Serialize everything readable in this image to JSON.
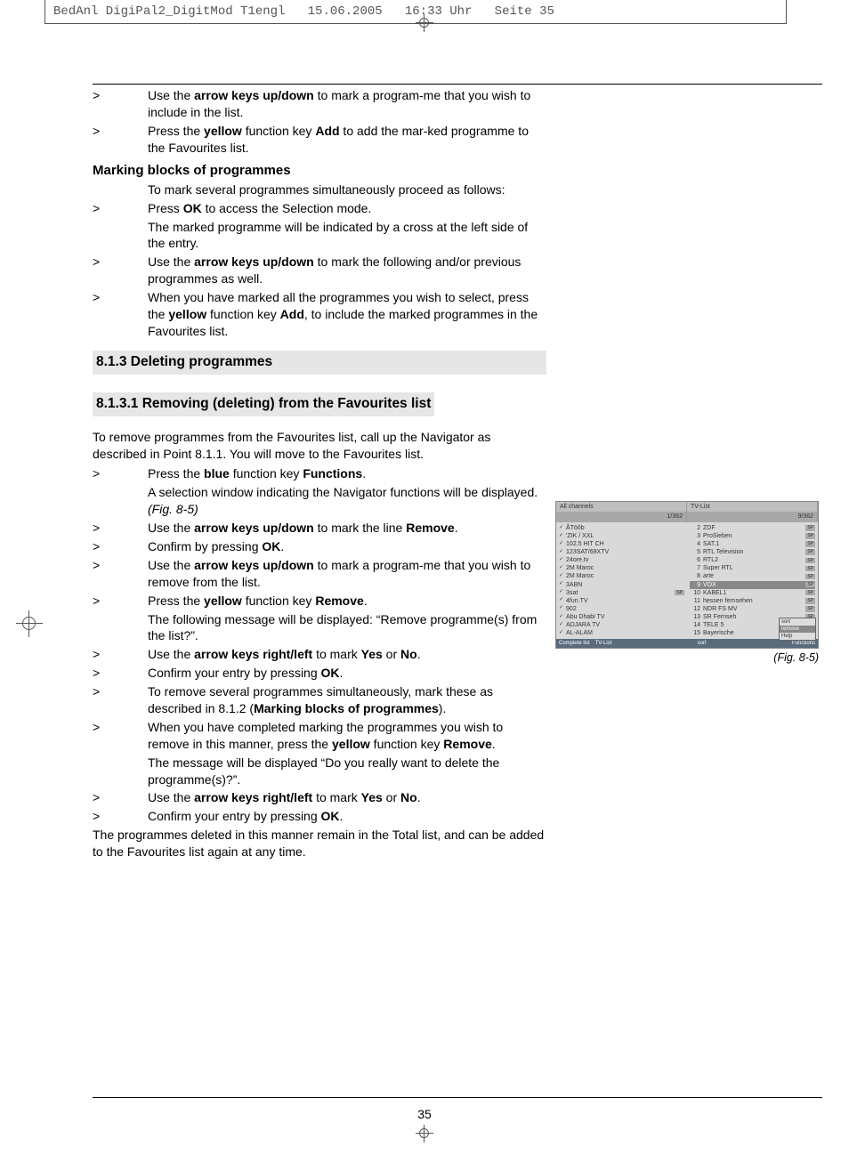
{
  "cropmark_header": "BedAnl DigiPal2_DigitMod T1engl   15.06.2005   16:33 Uhr   Seite 35",
  "page_number": "35",
  "intro_items": [
    {
      "bullet": ">",
      "runs": [
        [
          "",
          "Use the "
        ],
        [
          "b",
          "arrow keys up/down"
        ],
        [
          "",
          " to mark a program-me that you wish to include in the list."
        ]
      ]
    },
    {
      "bullet": ">",
      "runs": [
        [
          "",
          "Press the "
        ],
        [
          "b",
          "yellow"
        ],
        [
          "",
          " function key "
        ],
        [
          "b",
          "Add"
        ],
        [
          "",
          " to add the mar-ked programme to the Favourites list."
        ]
      ]
    }
  ],
  "marking_heading": "Marking blocks of programmes",
  "marking_block": [
    {
      "bullet": "",
      "runs": [
        [
          "",
          "To mark several programmes simultaneously proceed as follows:"
        ]
      ]
    },
    {
      "bullet": ">",
      "runs": [
        [
          "",
          "Press "
        ],
        [
          "bh",
          "OK"
        ],
        [
          "",
          " to access the Selection mode."
        ]
      ]
    },
    {
      "bullet": "",
      "runs": [
        [
          "",
          "The marked programme will be indicated by a cross at the left side of the entry."
        ]
      ]
    },
    {
      "bullet": ">",
      "runs": [
        [
          "",
          "Use the "
        ],
        [
          "b",
          "arrow keys up/down"
        ],
        [
          "",
          " to mark the following and/or previous programmes as well."
        ]
      ]
    },
    {
      "bullet": ">",
      "runs": [
        [
          "",
          "When you have marked all the programmes you wish to select, press the "
        ],
        [
          "b",
          "yellow"
        ],
        [
          "",
          " function key "
        ],
        [
          "b",
          "Add"
        ],
        [
          "",
          ", to include the marked programmes in the Favourites list."
        ]
      ]
    }
  ],
  "h_813": "8.1.3 Deleting programmes",
  "h_8131": "8.1.3.1 Removing (deleting) from the Favourites list",
  "para_8131": "To remove programmes from the Favourites list, call up the Navigator as described in Point 8.1.1. You will move to the Favourites list.",
  "steps_8131": [
    {
      "bullet": ">",
      "runs": [
        [
          "",
          "Press the "
        ],
        [
          "b",
          "blue"
        ],
        [
          "",
          " function key "
        ],
        [
          "b",
          "Functions"
        ],
        [
          "",
          "."
        ]
      ]
    },
    {
      "bullet": "",
      "runs": [
        [
          "",
          "A selection window indicating the Navigator functions will be displayed. "
        ],
        [
          "i",
          "(Fig. 8-5)"
        ]
      ]
    },
    {
      "bullet": ">",
      "runs": [
        [
          "",
          "Use the "
        ],
        [
          "b",
          "arrow keys up/down"
        ],
        [
          "",
          " to mark the line "
        ],
        [
          "b",
          "Remove"
        ],
        [
          "",
          "."
        ]
      ]
    },
    {
      "bullet": ">",
      "runs": [
        [
          "",
          "Confirm by pressing "
        ],
        [
          "bh",
          "OK"
        ],
        [
          "",
          "."
        ]
      ]
    },
    {
      "bullet": ">",
      "runs": [
        [
          "",
          "Use the "
        ],
        [
          "b",
          "arrow keys up/down"
        ],
        [
          "",
          " to mark a program-me that you wish to remove from the list."
        ]
      ]
    },
    {
      "bullet": ">",
      "runs": [
        [
          "",
          "Press the "
        ],
        [
          "b",
          "yellow"
        ],
        [
          "",
          " function key "
        ],
        [
          "b",
          "Remove"
        ],
        [
          "",
          "."
        ]
      ]
    },
    {
      "bullet": "",
      "runs": [
        [
          "",
          "The following message will be displayed: “Remove programme(s) from the list?”."
        ]
      ]
    },
    {
      "bullet": ">",
      "runs": [
        [
          "",
          "Use the "
        ],
        [
          "b",
          "arrow keys right/left"
        ],
        [
          "",
          " to mark "
        ],
        [
          "b",
          "Yes"
        ],
        [
          "",
          " or "
        ],
        [
          "b",
          "No"
        ],
        [
          "",
          "."
        ]
      ]
    },
    {
      "bullet": ">",
      "runs": [
        [
          "",
          "Confirm your entry by pressing "
        ],
        [
          "b",
          "OK"
        ],
        [
          "",
          "."
        ]
      ]
    },
    {
      "bullet": ">",
      "runs": [
        [
          "",
          "To remove several programmes simultaneously, mark these as described in 8.1.2 ("
        ],
        [
          "b",
          "Marking blocks of programmes"
        ],
        [
          "",
          ")."
        ]
      ]
    },
    {
      "bullet": ">",
      "runs": [
        [
          "",
          "When you have completed marking the programmes you wish to remove in this manner, press the "
        ],
        [
          "b",
          "yellow"
        ],
        [
          "",
          " function key "
        ],
        [
          "b",
          "Remove"
        ],
        [
          "",
          "."
        ]
      ]
    },
    {
      "bullet": "",
      "runs": [
        [
          "",
          "The message will be displayed “Do you really want to delete the programme(s)?”."
        ]
      ]
    },
    {
      "bullet": ">",
      "runs": [
        [
          "",
          "Use the "
        ],
        [
          "b",
          "arrow keys right/left"
        ],
        [
          "",
          " to mark "
        ],
        [
          "b",
          "Yes"
        ],
        [
          "",
          " or "
        ],
        [
          "b",
          "No"
        ],
        [
          "",
          "."
        ]
      ]
    },
    {
      "bullet": ">",
      "runs": [
        [
          "",
          "Confirm your entry by pressing "
        ],
        [
          "b",
          "OK"
        ],
        [
          "",
          "."
        ]
      ]
    }
  ],
  "outro_8131": "The programmes deleted in this manner remain in the Total list, and can be added to the Favourites list again at any time.",
  "figure": {
    "caption": "(Fig. 8-5)",
    "hdr_left": "All channels",
    "hdr_right": "TV-List",
    "count_left": "1/362",
    "count_right": "9/362",
    "left_col": [
      "ÅTöôb",
      "'ZIK / XXL",
      "102.5 HIT CH",
      "123SAT/69XTV",
      "24ore.tv",
      "2M Maroc",
      "2M Maroc",
      "3ABN",
      "3sat",
      "4fun.TV",
      "902",
      "Abu Dhabi TV",
      "ADJARA TV",
      "AL-ALAM"
    ],
    "right_col": [
      {
        "n": "2",
        "t": "ZDF"
      },
      {
        "n": "3",
        "t": "ProSieben"
      },
      {
        "n": "4",
        "t": "SAT.1"
      },
      {
        "n": "5",
        "t": "RTL Television"
      },
      {
        "n": "6",
        "t": "RTL2"
      },
      {
        "n": "7",
        "t": "Super RTL"
      },
      {
        "n": "8",
        "t": "arte"
      },
      {
        "n": "9",
        "t": "VOX"
      },
      {
        "n": "10",
        "t": "KABEL1"
      },
      {
        "n": "11",
        "t": "hessen fernsehen"
      },
      {
        "n": "12",
        "t": "NDR FS MV"
      },
      {
        "n": "13",
        "t": "SR Fernseh"
      },
      {
        "n": "14",
        "t": "TELE 5"
      },
      {
        "n": "15",
        "t": "Bayerische"
      }
    ],
    "popup": [
      "sort",
      "remove",
      "Help"
    ],
    "footer": [
      "Complete list",
      "TV-List",
      "sort",
      "Functions"
    ]
  }
}
